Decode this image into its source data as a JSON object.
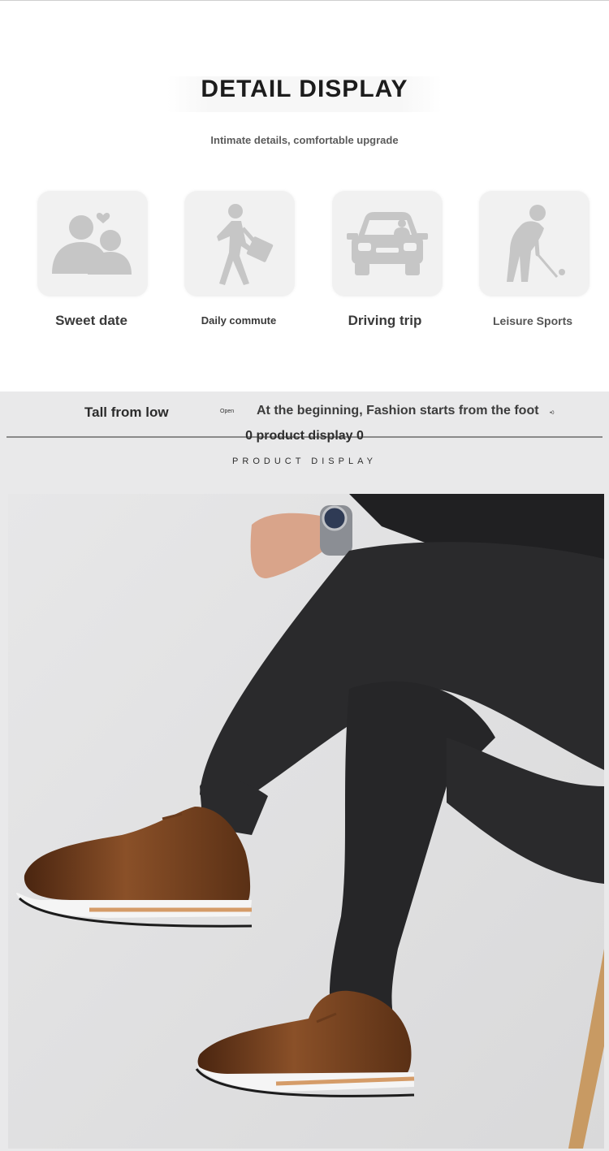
{
  "detail": {
    "title": "DETAIL DISPLAY",
    "subtitle": "Intimate details, comfortable upgrade",
    "scenarios": [
      {
        "label": "Sweet date",
        "icon": "couple-heart-icon"
      },
      {
        "label": "Daily commute",
        "icon": "walking-briefcase-icon"
      },
      {
        "label": "Driving trip",
        "icon": "car-icon"
      },
      {
        "label": "Leisure Sports",
        "icon": "golfer-icon"
      }
    ]
  },
  "product": {
    "tagline_left": "Tall from low",
    "tagline_open": "Open",
    "tagline_right": "At the beginning, Fashion starts from the foot",
    "tagline_mark": "•0",
    "heading": "0 product display 0",
    "subheading": "PRODUCT DISPLAY",
    "photo_alt": "Man in black trousers wearing brown brogue sneakers with white soles"
  },
  "colors": {
    "icon_gray": "#c6c6c6",
    "tile_bg": "#f1f1f1",
    "product_bg": "#e9e9ea",
    "shoe_brown": "#6b3a1f",
    "trousers": "#2a2a2c"
  }
}
